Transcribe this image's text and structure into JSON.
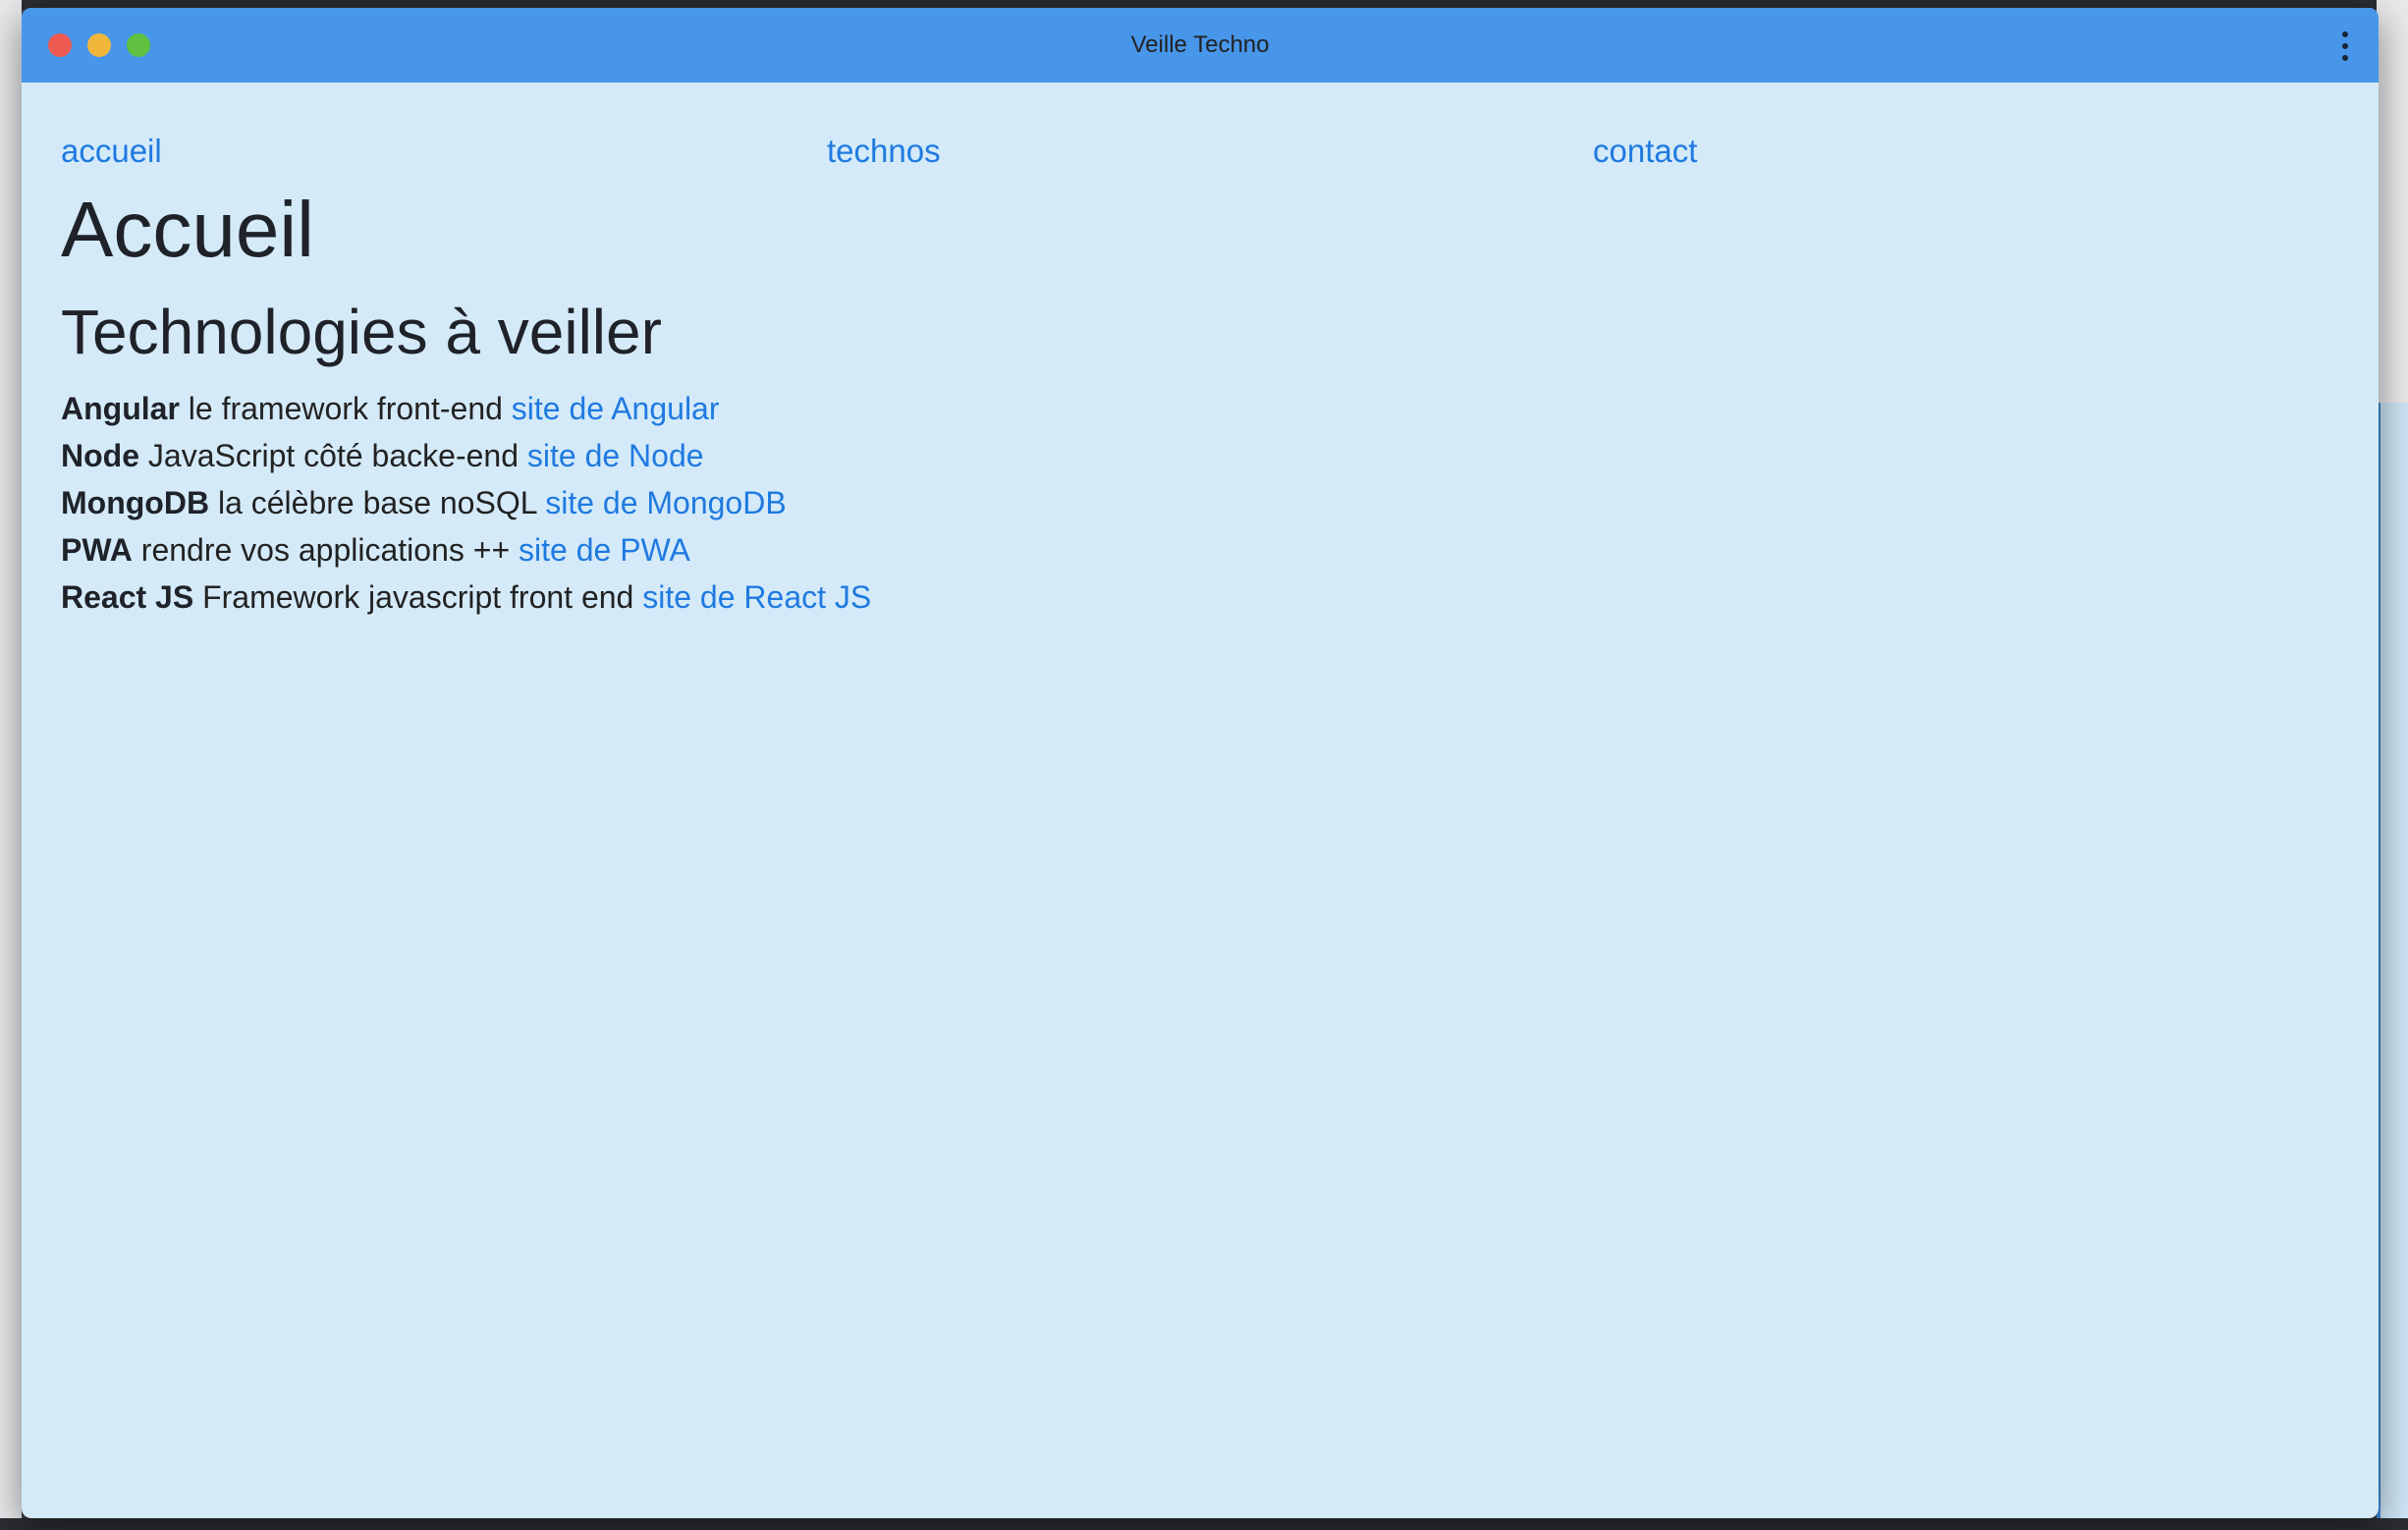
{
  "window": {
    "title": "Veille Techno"
  },
  "nav": {
    "items": [
      {
        "label": "accueil"
      },
      {
        "label": "technos"
      },
      {
        "label": "contact"
      }
    ]
  },
  "page": {
    "title": "Accueil",
    "subtitle": "Technologies à veiller"
  },
  "technologies": [
    {
      "name": "Angular",
      "description": "le framework front-end",
      "link": "site de Angular"
    },
    {
      "name": "Node",
      "description": "JavaScript côté backe-end",
      "link": "site de Node"
    },
    {
      "name": "MongoDB",
      "description": "la célèbre base noSQL",
      "link": "site de MongoDB"
    },
    {
      "name": "PWA",
      "description": "rendre vos applications ++",
      "link": "site de PWA"
    },
    {
      "name": "React JS",
      "description": "Framework javascript front end",
      "link": "site de React JS"
    }
  ],
  "colors": {
    "titlebar": "#4796ea",
    "background": "#d4eaf9",
    "link": "#1f7ae0",
    "text": "#1f2229"
  }
}
